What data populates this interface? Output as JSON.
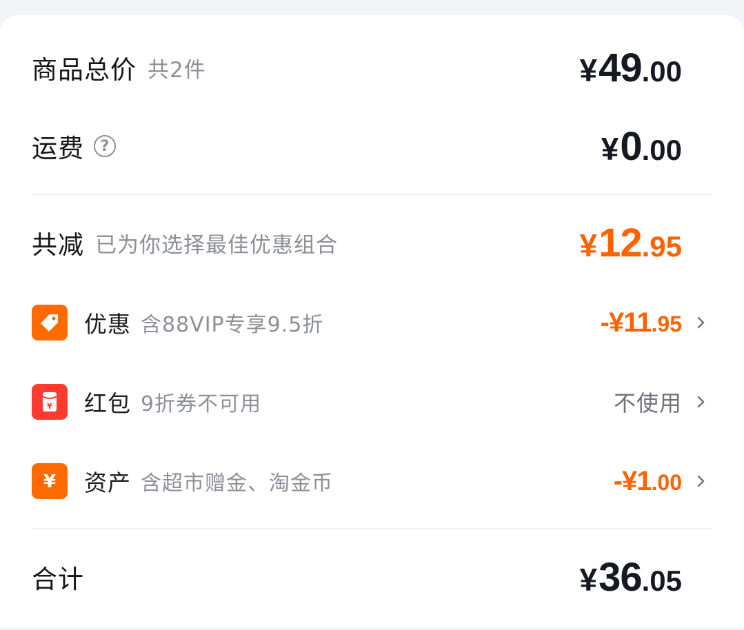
{
  "summary": {
    "goods_total": {
      "title": "商品总价",
      "sub": "共2件",
      "currency": "¥",
      "int": "49",
      "dec": ".00"
    },
    "shipping": {
      "title": "运费",
      "help_glyph": "?",
      "currency": "¥",
      "int": "0",
      "dec": ".00"
    },
    "discount": {
      "title": "共减",
      "sub": "已为你选择最佳优惠组合",
      "currency": "¥",
      "int": "12",
      "dec": ".95",
      "color": "#ff6200"
    },
    "items": [
      {
        "title": "优惠",
        "desc": "含88VIP专享9.5折",
        "amount_int": "-¥11",
        "amount_dec": ".95",
        "icon": "tag-icon",
        "badge_color": "#ff6a00"
      },
      {
        "title": "红包",
        "desc": "9折券不可用",
        "status": "不使用",
        "icon": "red-packet-icon",
        "badge_color": "#ff3a2f"
      },
      {
        "title": "资产",
        "desc": "含超市赠金、淘金币",
        "amount_int": "-¥1",
        "amount_dec": ".00",
        "icon": "yuan-coin-icon",
        "badge_color": "#ff6a00"
      }
    ],
    "total": {
      "title": "合计",
      "currency": "¥",
      "int": "36",
      "dec": ".05"
    }
  }
}
